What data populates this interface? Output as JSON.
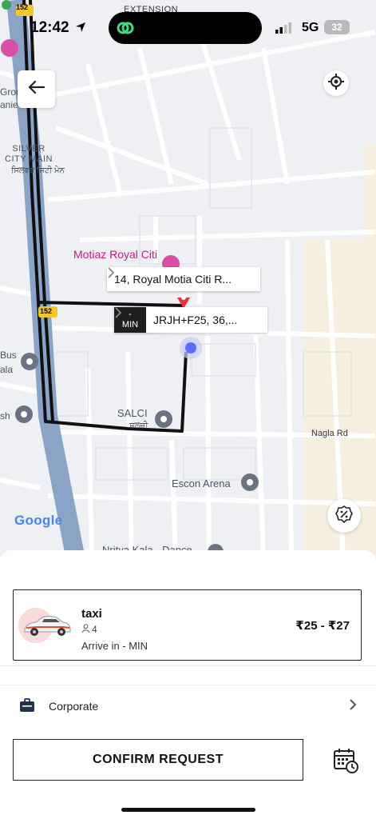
{
  "status_bar": {
    "time": "12:42",
    "network": "5G",
    "battery": "32"
  },
  "map": {
    "labels": {
      "silver_city_main": "SILVER CITY MAIN",
      "silver_city_local": "ਸਿਲਵਰ ਸਿਟੀ ਮੇਨ",
      "motiaz": "Motiaz Royal Citi",
      "salci": "SALCI",
      "salci_local": "ਸਲਚੀ",
      "nagla": "Nagla Rd",
      "escon": "Escon Arena",
      "nritya": "Nritya Kala - Dance",
      "bus": "Bus",
      "bus2": "ala",
      "sh": "sh",
      "group": "Grou",
      "group2": "anie",
      "extension": "EXTENSION",
      "road_152_top": "152",
      "road_152_mid": "152"
    },
    "google": "Google",
    "pickup_address": "14, Royal Motia Citi R...",
    "drop_eta_top": "-",
    "drop_eta_bottom": "MIN",
    "drop_address": "JRJH+F25, 36,..."
  },
  "ride": {
    "name": "taxi",
    "seats": "4",
    "eta": "Arrive in - MIN",
    "fare": "₹25 - ₹27"
  },
  "payment": {
    "label": "Corporate"
  },
  "confirm": {
    "label": "CONFIRM REQUEST"
  },
  "colors": {
    "route": "#111111",
    "highway": "#8aa4c8",
    "pin": "#e8323c",
    "current": "#5b6cff"
  }
}
